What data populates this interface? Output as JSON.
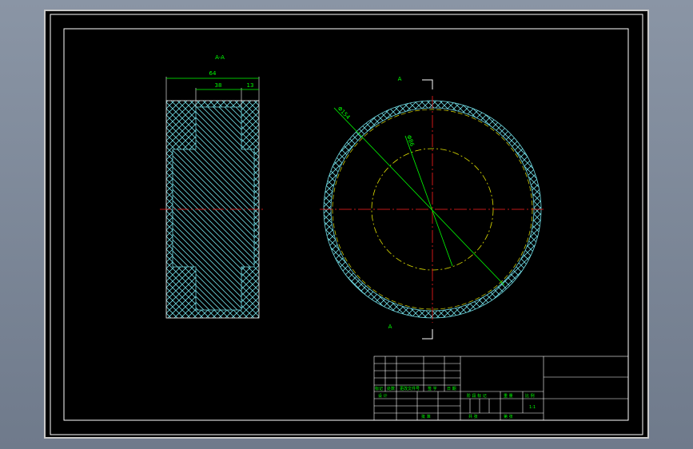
{
  "colors": {
    "background": "#000000",
    "frame": "#ffffff",
    "hatch": "#6fd8e0",
    "dimension": "#00ff00",
    "centerline": "#ff2020",
    "hidden_circle": "#e0e000",
    "app_bg": "#7f8a9a"
  },
  "section_view": {
    "title": "A-A",
    "dim_total_width": "64",
    "dim_inner_width": "38",
    "dim_offset": "13"
  },
  "circle_view": {
    "section_mark_top": "A",
    "section_mark_bottom": "A",
    "dim_outer_diameter": "Φ154",
    "dim_inner_diameter": "Φ86"
  },
  "title_block": {
    "row_labels": [
      "标记",
      "处数",
      "更改文件号",
      "签 字",
      "日 期"
    ],
    "design_label": "设 计",
    "stage_label": "阶 段 标 记",
    "weight_label": "重 量",
    "scale_label": "比 例",
    "scale_value": "1:1",
    "approve_label": "批 准",
    "sheets_label": "共    张",
    "sheet_label": "第    张"
  }
}
